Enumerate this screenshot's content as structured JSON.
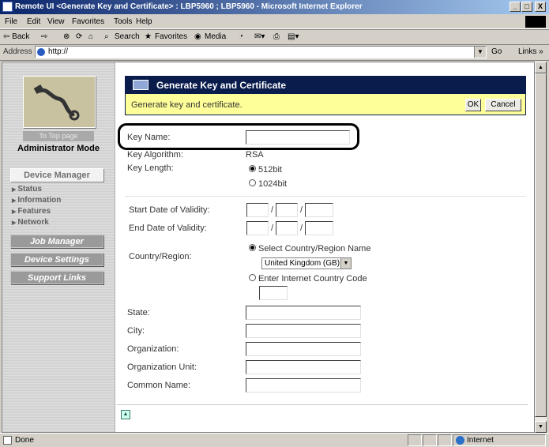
{
  "window": {
    "title": "Remote UI <Generate Key and Certificate> : LBP5960 ; LBP5960 - Microsoft Internet Explorer",
    "min": "_",
    "max": "□",
    "close": "X"
  },
  "menubar": {
    "items": [
      "File",
      "Edit",
      "View",
      "Favorites",
      "Tools",
      "Help"
    ]
  },
  "toolbar": {
    "back": "⇦ Back",
    "forward": "⇨",
    "search": "Search",
    "favorites": "Favorites",
    "media": "Media"
  },
  "address": {
    "label": "Address",
    "url": "http://",
    "go": "Go",
    "links": "Links »"
  },
  "sidebar": {
    "top_page": "To Top page",
    "mode": "Administrator Mode",
    "device_manager": "Device Manager",
    "sub_items": [
      "Status",
      "Information",
      "Features",
      "Network"
    ],
    "job_manager": "Job Manager",
    "device_settings": "Device Settings",
    "support_links": "Support Links"
  },
  "dialog": {
    "title": "Generate Key and Certificate",
    "instruction": "Generate key and certificate.",
    "ok": "OK",
    "cancel": "Cancel"
  },
  "form": {
    "key_name_label": "Key Name:",
    "key_name_value": "",
    "key_algorithm_label": "Key Algorithm:",
    "key_algorithm_value": "RSA",
    "key_length_label": "Key Length:",
    "key_length_options": [
      "512bit",
      "1024bit"
    ],
    "key_length_selected": "512bit",
    "start_date_label": "Start Date of Validity:",
    "end_date_label": "End Date of Validity:",
    "date_sep": "/",
    "country_label": "Country/Region:",
    "country_option_select": "Select Country/Region Name",
    "country_selected": "United Kingdom (GB)",
    "country_option_code": "Enter Internet Country Code",
    "state_label": "State:",
    "city_label": "City:",
    "organization_label": "Organization:",
    "org_unit_label": "Organization Unit:",
    "common_name_label": "Common Name:"
  },
  "statusbar": {
    "status": "Done",
    "zone": "Internet"
  }
}
